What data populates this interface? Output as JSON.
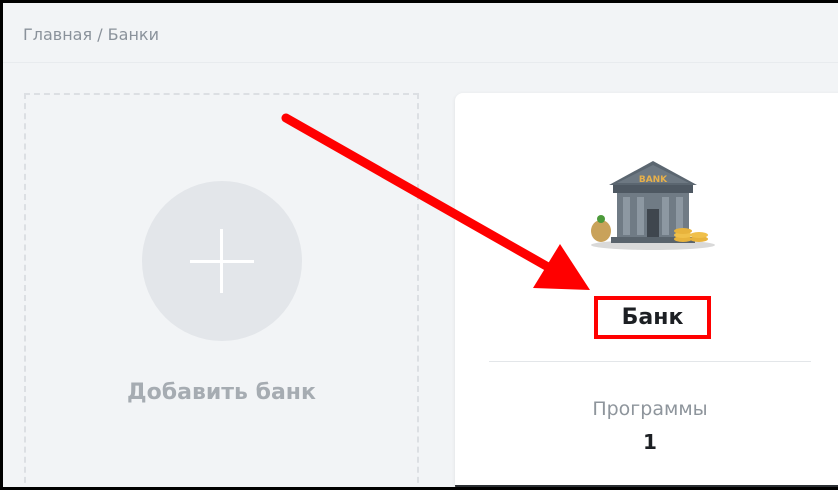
{
  "breadcrumb": {
    "home": "Главная",
    "separator": " / ",
    "current": "Банки"
  },
  "add_card": {
    "label": "Добавить банк",
    "icon": "plus-icon"
  },
  "bank_card": {
    "icon": "bank-building-icon",
    "icon_text": "BANK",
    "name": "Банк",
    "programs_label": "Программы",
    "programs_count": "1"
  },
  "annotation": {
    "arrow_color": "#ff0000",
    "highlight_color": "#ff0000"
  }
}
